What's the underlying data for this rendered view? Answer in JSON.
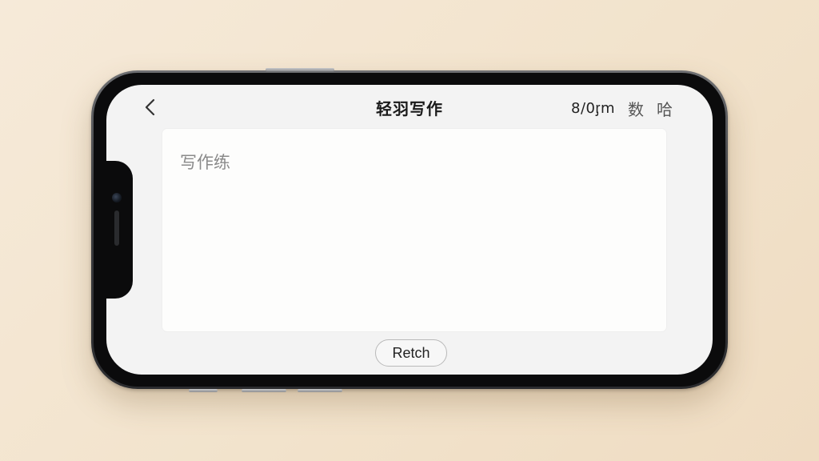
{
  "app": {
    "title": "轻羽写作"
  },
  "header": {
    "back_icon": "chevron-left-icon",
    "word_count": "8/0ᶉm",
    "action_1": "数",
    "action_2": "哈"
  },
  "editor": {
    "placeholder": "写作练",
    "value": ""
  },
  "footer": {
    "button_label": "Retch"
  },
  "colors": {
    "background": "#f2e3cc",
    "screen": "#f3f3f3",
    "editor": "#fdfdfc",
    "title_text": "#1a1a1a"
  }
}
